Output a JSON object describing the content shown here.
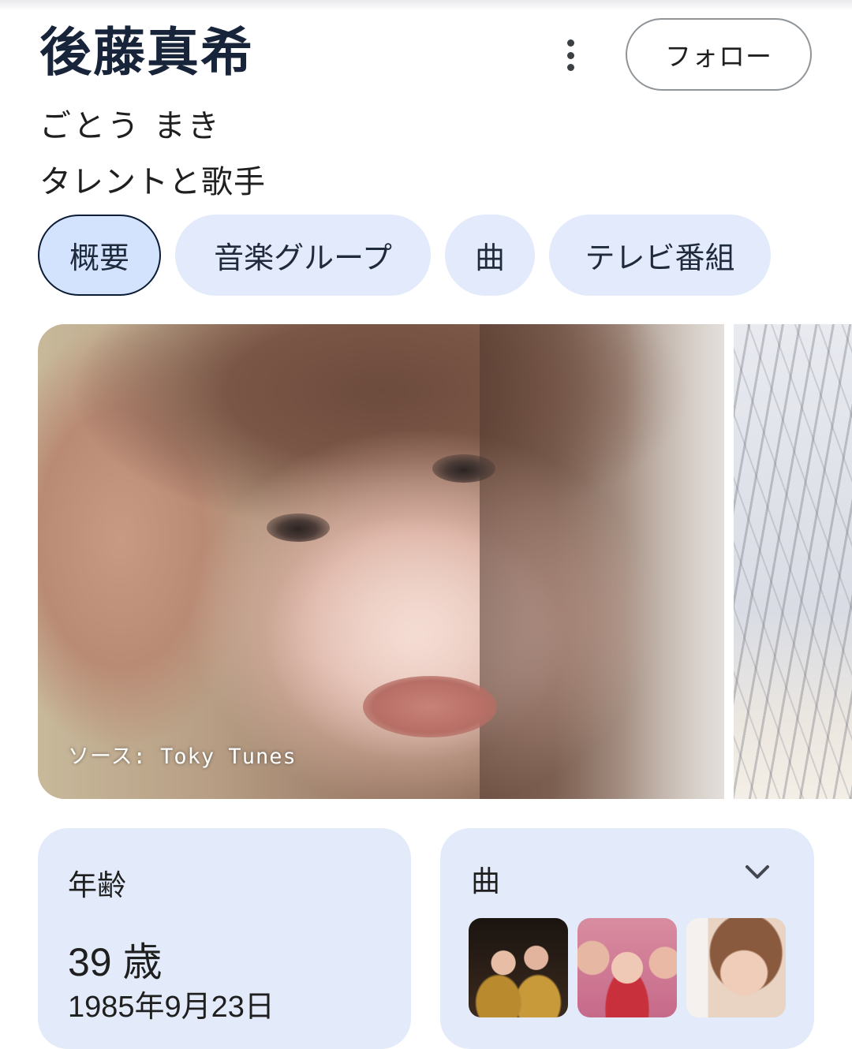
{
  "header": {
    "name": "後藤真希",
    "reading": "ごとう まき",
    "description": "タレントと歌手",
    "follow_label": "フォロー"
  },
  "tabs": [
    {
      "label": "概要",
      "active": true
    },
    {
      "label": "音楽グループ",
      "active": false
    },
    {
      "label": "曲",
      "active": false
    },
    {
      "label": "テレビ番組",
      "active": false
    }
  ],
  "gallery": {
    "source_caption": "ソース: Toky Tunes"
  },
  "age_card": {
    "label": "年齢",
    "value": "39 歳",
    "birthdate": "1985年9月23日"
  },
  "songs_card": {
    "label": "曲",
    "expand_icon": "chevron-down-icon"
  },
  "colors": {
    "chip_bg": "#e2eafb",
    "chip_active_bg": "#d3e3fd",
    "card_bg": "#e3ebfb",
    "title": "#17243a"
  }
}
